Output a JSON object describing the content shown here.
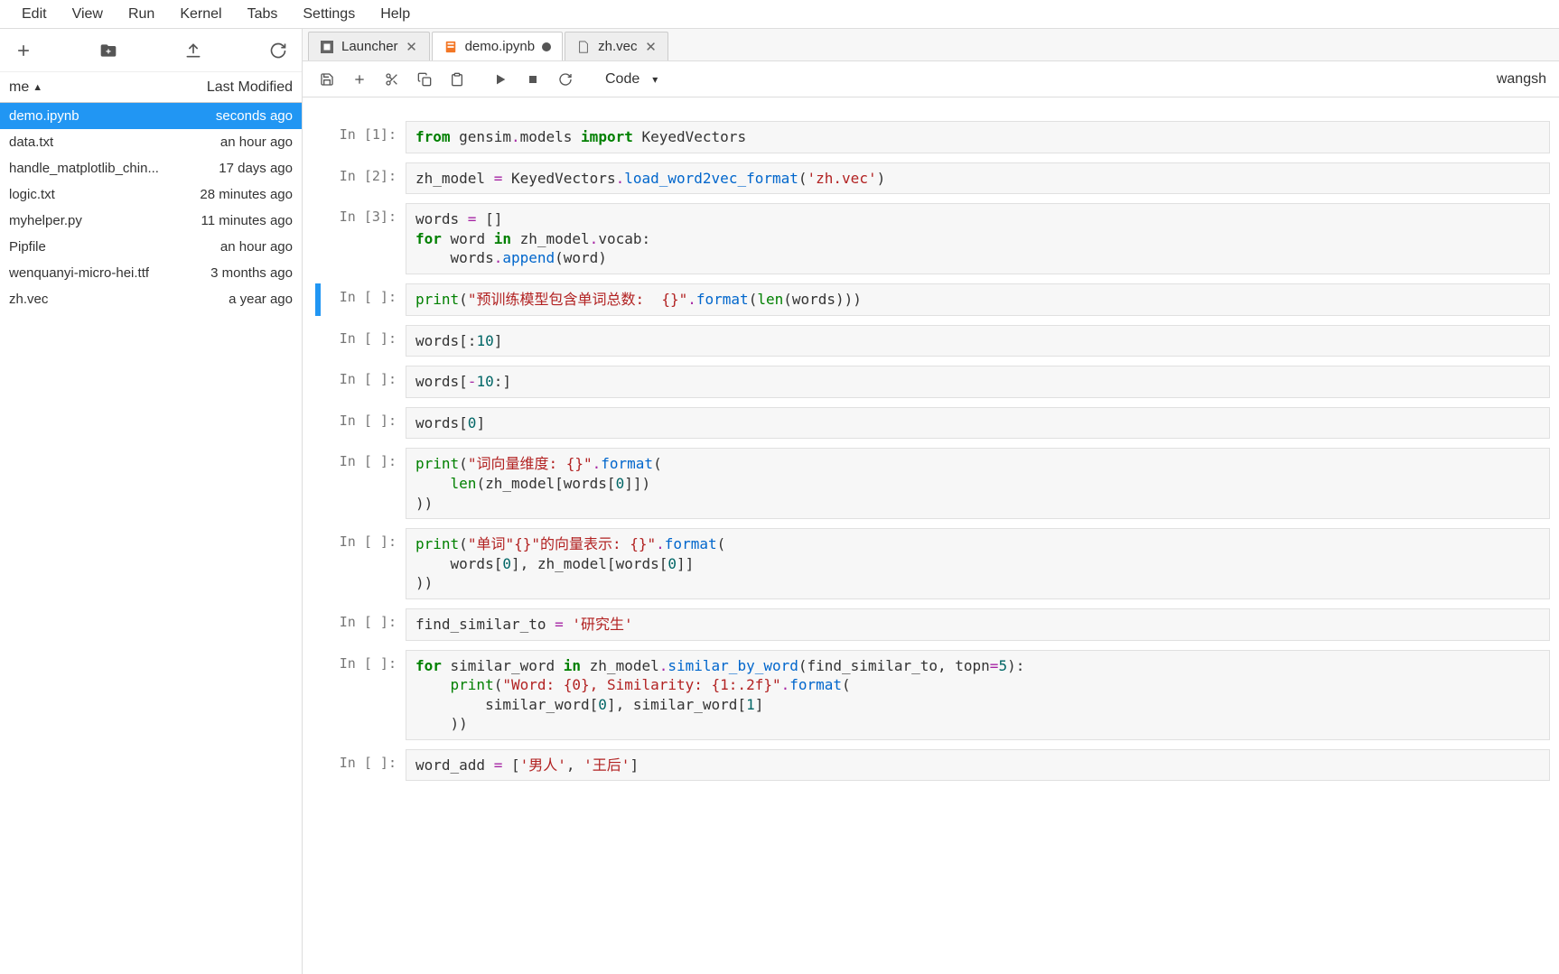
{
  "menu": {
    "items": [
      "Edit",
      "View",
      "Run",
      "Kernel",
      "Tabs",
      "Settings",
      "Help"
    ]
  },
  "file_toolbar": {
    "new": "plus-icon",
    "new_folder": "folder-plus-icon",
    "upload": "upload-icon",
    "refresh": "refresh-icon"
  },
  "file_header": {
    "name_col": "me",
    "modified_col": "Last Modified"
  },
  "files": [
    {
      "name": "demo.ipynb",
      "modified": "seconds ago",
      "selected": true
    },
    {
      "name": "data.txt",
      "modified": "an hour ago"
    },
    {
      "name": "handle_matplotlib_chin...",
      "modified": "17 days ago"
    },
    {
      "name": "logic.txt",
      "modified": "28 minutes ago"
    },
    {
      "name": "myhelper.py",
      "modified": "11 minutes ago"
    },
    {
      "name": "Pipfile",
      "modified": "an hour ago"
    },
    {
      "name": "wenquanyi-micro-hei.ttf",
      "modified": "3 months ago"
    },
    {
      "name": "zh.vec",
      "modified": "a year ago"
    }
  ],
  "tabs": [
    {
      "label": "Launcher",
      "icon": "launcher",
      "active": false,
      "dirty": false
    },
    {
      "label": "demo.ipynb",
      "icon": "notebook",
      "active": true,
      "dirty": true
    },
    {
      "label": "zh.vec",
      "icon": "file",
      "active": false,
      "dirty": false
    }
  ],
  "nb_toolbar": {
    "cell_type": "Code",
    "kernel_label": "wangsh"
  },
  "cells": [
    {
      "prompt": "In [1]:",
      "code_html": "<span class='kw'>from</span> gensim<span class='op'>.</span>models <span class='kw'>import</span> KeyedVectors"
    },
    {
      "prompt": "In [2]:",
      "code_html": "zh_model <span class='op'>=</span> KeyedVectors<span class='op'>.</span><span class='fn'>load_word2vec_format</span>(<span class='str'>'zh.vec'</span>)"
    },
    {
      "prompt": "In [3]:",
      "code_html": "words <span class='op'>=</span> []\n<span class='kw'>for</span> word <span class='kw'>in</span> zh_model<span class='op'>.</span>vocab:\n    words<span class='op'>.</span><span class='fn'>append</span>(word)"
    },
    {
      "prompt": "In [ ]:",
      "selected": true,
      "code_html": "<span class='builtin'>print</span>(<span class='str'>\"预训练模型包含单词总数:  {}\"</span><span class='op'>.</span><span class='fn'>format</span>(<span class='builtin'>len</span>(words)))"
    },
    {
      "prompt": "In [ ]:",
      "code_html": "words[:<span class='num'>10</span>]"
    },
    {
      "prompt": "In [ ]:",
      "code_html": "words[<span class='op'>-</span><span class='num'>10</span>:]"
    },
    {
      "prompt": "In [ ]:",
      "code_html": "words[<span class='num'>0</span>]"
    },
    {
      "prompt": "In [ ]:",
      "code_html": "<span class='builtin'>print</span>(<span class='str'>\"词向量维度: {}\"</span><span class='op'>.</span><span class='fn'>format</span>(\n    <span class='builtin'>len</span>(zh_model[words[<span class='num'>0</span>]])\n))"
    },
    {
      "prompt": "In [ ]:",
      "code_html": "<span class='builtin'>print</span>(<span class='str'>\"单词\"{}\"的向量表示: {}\"</span><span class='op'>.</span><span class='fn'>format</span>(\n    words[<span class='num'>0</span>], zh_model[words[<span class='num'>0</span>]]\n))"
    },
    {
      "prompt": "In [ ]:",
      "code_html": "find_similar_to <span class='op'>=</span> <span class='str'>'研究生'</span>"
    },
    {
      "prompt": "In [ ]:",
      "code_html": "<span class='kw'>for</span> similar_word <span class='kw'>in</span> zh_model<span class='op'>.</span><span class='fn'>similar_by_word</span>(find_similar_to, topn<span class='op'>=</span><span class='num'>5</span>):\n    <span class='builtin'>print</span>(<span class='str'>\"Word: {0}, Similarity: {1:.2f}\"</span><span class='op'>.</span><span class='fn'>format</span>(\n        similar_word[<span class='num'>0</span>], similar_word[<span class='num'>1</span>]\n    ))"
    },
    {
      "prompt": "In [ ]:",
      "code_html": "word_add <span class='op'>=</span> [<span class='str'>'男人'</span>, <span class='str'>'王后'</span>]"
    }
  ]
}
